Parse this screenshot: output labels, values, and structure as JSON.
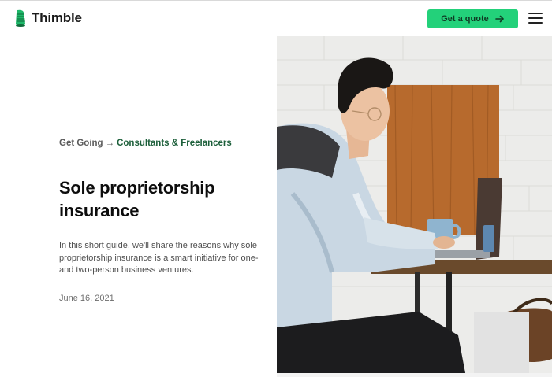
{
  "header": {
    "brand": "Thimble",
    "cta_label": "Get a quote",
    "brand_color": "#23d17a"
  },
  "breadcrumb": {
    "parent": "Get Going",
    "separator": "→",
    "current": "Consultants & Freelancers"
  },
  "article": {
    "title": "Sole proprietorship insurance",
    "intro": "In this short guide, we'll share the reasons why sole proprietorship insurance is a smart initiative for one- and two-person business ventures.",
    "date": "June 16, 2021"
  },
  "icons": {
    "logo": "thimble-logo-icon",
    "cta_arrow": "arrow-right-icon",
    "menu": "hamburger-menu-icon"
  }
}
